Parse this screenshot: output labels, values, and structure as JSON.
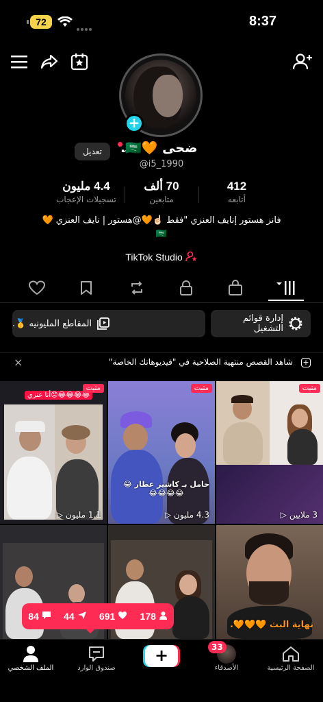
{
  "status_bar": {
    "battery": "72",
    "time": "8:37"
  },
  "profile": {
    "name": "ضحى 🧡🇸🇦.",
    "handle": "@i5_1990",
    "edit_label": "تعديل",
    "stats": [
      {
        "value": "412",
        "label": "أتابعه"
      },
      {
        "value": "70 ألف",
        "label": "متابعين"
      },
      {
        "value": "4.4 مليون",
        "label": "تسجيلات الإعجاب"
      }
    ],
    "bio_line1": "فانز هستور إنايف العنزي \"فقط ☝🏻🧡@هستور | نايف العنزي 🧡",
    "bio_line2": "🇸🇦",
    "studio_label": "TikTok Studio"
  },
  "tabs": [
    "videos-grid",
    "private",
    "reposts",
    "favorites",
    "liked"
  ],
  "actions": {
    "playlists": "إدارة قوائم التشغيل",
    "million": "المقاطع المليونيه 🥇."
  },
  "notice": {
    "text": "شاهد القصص منتهية الصلاحية في \"فيديوهاتك الخاصة\"",
    "close": "×"
  },
  "videos": [
    {
      "pinned": "مثبت",
      "views": "1.1 مليون",
      "caption": "😂😂😂😂😡أنا عنزي"
    },
    {
      "pinned": "مثبت",
      "views": "4.3 مليون",
      "caption": "حامل بـ كاشير عطار 😂😂😂😂😂"
    },
    {
      "pinned": "مثبت",
      "views": "3 ملايين",
      "caption": ""
    },
    {
      "views": "",
      "caption": ""
    },
    {
      "views": "",
      "caption": ""
    },
    {
      "views": "",
      "caption": "نهاية البث 🧡🧡🧡."
    }
  ],
  "live_stats": {
    "viewers": "178",
    "likes": "691",
    "shares": "44",
    "comments": "84"
  },
  "nav": {
    "home": "الصفحة الرئيسية",
    "friends": "الأصدقاء",
    "friends_badge": "33",
    "inbox": "صندوق الوارد",
    "profile": "الملف الشخصي",
    "create": "+"
  }
}
